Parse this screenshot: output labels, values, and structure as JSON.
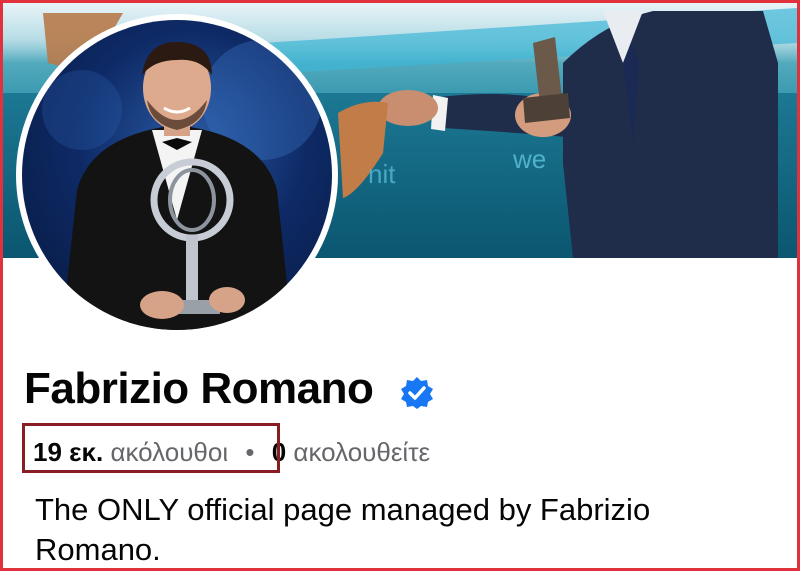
{
  "profile": {
    "name": "Fabrizio Romano",
    "verified": true,
    "verified_icon": "verified-badge-icon",
    "followers_count": "19 εκ.",
    "followers_label": "ακόλουθοι",
    "separator": "•",
    "following_count": "0",
    "following_label": "ακολουθείτε",
    "bio": "The ONLY official page managed by Fabrizio Romano."
  },
  "colors": {
    "verified_blue": "#1877f2",
    "frame_red": "#e0313c",
    "highlight_box": "#8a1c24",
    "muted_text": "#65676b"
  }
}
